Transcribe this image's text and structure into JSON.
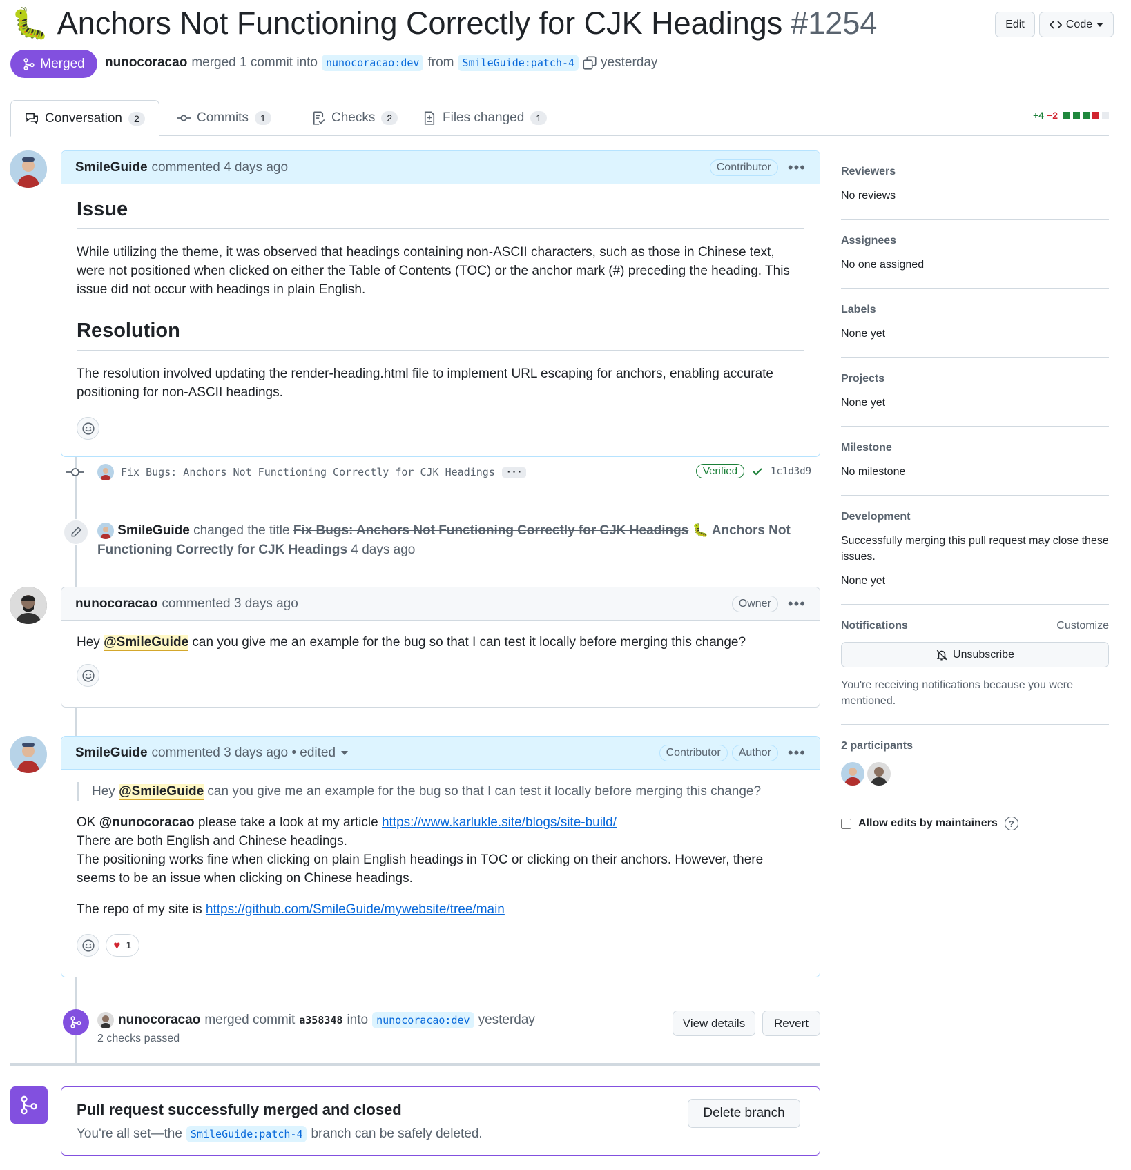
{
  "pr": {
    "emoji": "🐛",
    "title": "Anchors Not Functioning Correctly for CJK Headings",
    "number": "#1254",
    "state": "Merged",
    "merger": "nunocoracao",
    "merged_text": "merged 1 commit into",
    "base": "nunocoracao:dev",
    "from_text": "from",
    "head": "SmileGuide:patch-4",
    "when": "yesterday",
    "edit_label": "Edit",
    "code_label": "Code"
  },
  "tabs": [
    {
      "label": "Conversation",
      "count": "2"
    },
    {
      "label": "Commits",
      "count": "1"
    },
    {
      "label": "Checks",
      "count": "2"
    },
    {
      "label": "Files changed",
      "count": "1"
    }
  ],
  "diffstat": {
    "add": "+4",
    "del": "−2"
  },
  "comment1": {
    "author": "SmileGuide",
    "time": "commented 4 days ago",
    "badge": "Contributor",
    "h_issue": "Issue",
    "p_issue": "While utilizing the theme, it was observed that headings containing non-ASCII characters, such as those in Chinese text, were not positioned when clicked on either the Table of Contents (TOC) or the anchor mark (#) preceding the heading. This issue did not occur with headings in plain English.",
    "h_res": "Resolution",
    "p_res": "The resolution involved updating the render-heading.html file to implement URL escaping for anchors, enabling accurate positioning for non-ASCII headings."
  },
  "commit": {
    "message": "Fix Bugs: Anchors Not Functioning Correctly for CJK Headings",
    "verified": "Verified",
    "sha": "1c1d3d9"
  },
  "rename": {
    "author": "SmileGuide",
    "action": "changed the title",
    "old": "Fix Bugs: Anchors Not Functioning Correctly for CJK Headings",
    "new_line1": "🐛 Anchors Not",
    "new_line2": "Functioning Correctly for CJK Headings",
    "time": "4 days ago"
  },
  "comment2": {
    "author": "nunocoracao",
    "time": "commented 3 days ago",
    "badge": "Owner",
    "pre": "Hey",
    "mention": "@SmileGuide",
    "post": "can you give me an example for the bug so that I can test it locally before merging this change?"
  },
  "comment3": {
    "author": "SmileGuide",
    "time": "commented 3 days ago • edited",
    "badge1": "Contributor",
    "badge2": "Author",
    "q_pre": "Hey",
    "q_mention": "@SmileGuide",
    "q_post": "can you give me an example for the bug so that I can test it locally before merging this change?",
    "l1_pre": "OK",
    "l1_mention": "@nunocoracao",
    "l1_mid": "please take a look at my article",
    "l1_link": "https://www.karlukle.site/blogs/site-build/",
    "l2": "There are both English and Chinese headings.",
    "l3": "The positioning works fine when clicking on plain English headings in TOC or clicking on their anchors. However, there seems to be an issue when clicking on Chinese headings.",
    "l4_pre": "The repo of my site is",
    "l4_link": "https://github.com/SmileGuide/mywebsite/tree/main",
    "heart_count": "1"
  },
  "merge_event": {
    "author": "nunocoracao",
    "text": "merged commit",
    "sha": "a358348",
    "into": "into",
    "branch": "nunocoracao:dev",
    "time": "yesterday",
    "checks": "2 checks passed",
    "view_details": "View details",
    "revert": "Revert"
  },
  "merged_box": {
    "title": "Pull request successfully merged and closed",
    "pre": "You're all set—the",
    "branch": "SmileGuide:patch-4",
    "post": "branch can be safely deleted.",
    "delete_label": "Delete branch"
  },
  "sidebar": {
    "reviewers_h": "Reviewers",
    "reviewers_v": "No reviews",
    "assignees_h": "Assignees",
    "assignees_v": "No one assigned",
    "labels_h": "Labels",
    "labels_v": "None yet",
    "projects_h": "Projects",
    "projects_v": "None yet",
    "milestone_h": "Milestone",
    "milestone_v": "No milestone",
    "dev_h": "Development",
    "dev_text": "Successfully merging this pull request may close these issues.",
    "dev_v": "None yet",
    "notif_h": "Notifications",
    "customize": "Customize",
    "unsubscribe": "Unsubscribe",
    "notif_text": "You're receiving notifications because you were mentioned.",
    "participants_h": "2 participants",
    "allow_edits": "Allow edits by maintainers"
  },
  "colors": {
    "merged": "#8250df",
    "link": "#0969da",
    "add": "#1a7f37",
    "del": "#d1242f"
  }
}
